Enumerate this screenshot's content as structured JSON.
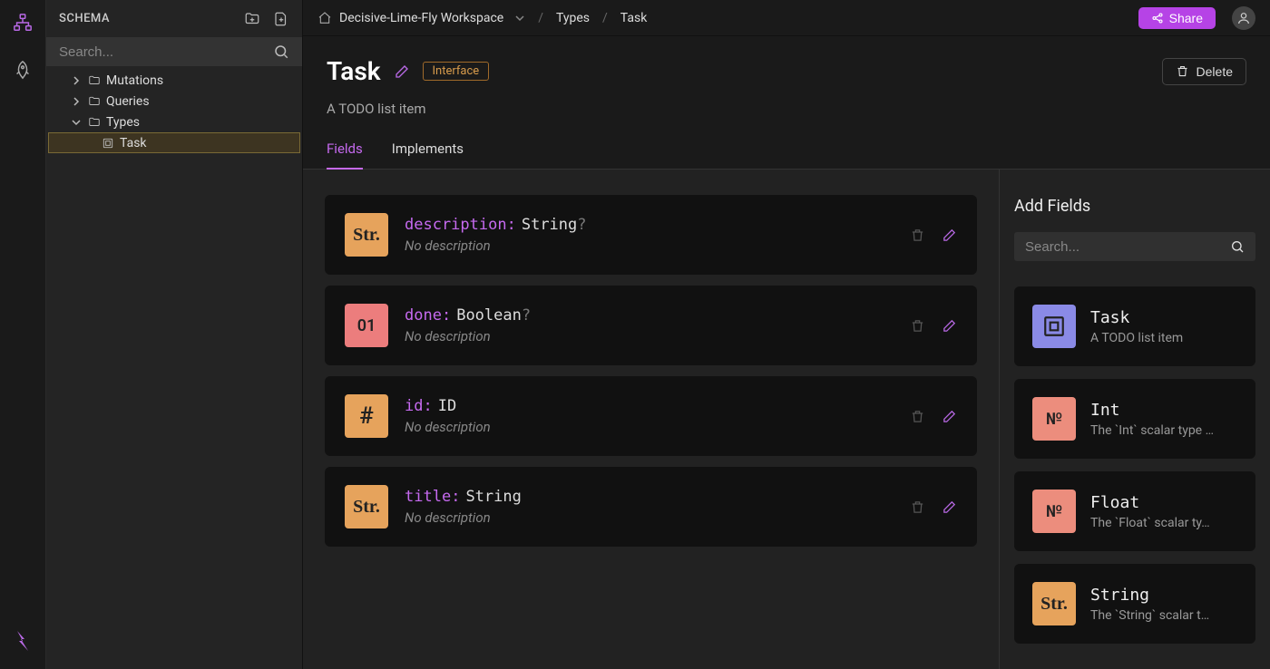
{
  "sidebar": {
    "title": "SCHEMA",
    "search_placeholder": "Search...",
    "items": [
      {
        "label": "Mutations",
        "expanded": false
      },
      {
        "label": "Queries",
        "expanded": false
      },
      {
        "label": "Types",
        "expanded": true
      }
    ],
    "type_children": [
      {
        "label": "Task",
        "selected": true
      }
    ]
  },
  "breadcrumb": {
    "workspace": "Decisive-Lime-Fly Workspace",
    "section": "Types",
    "item": "Task"
  },
  "topbar": {
    "share": "Share"
  },
  "page": {
    "title": "Task",
    "badge": "Interface",
    "delete": "Delete",
    "subtitle": "A TODO list item"
  },
  "tabs": {
    "fields": "Fields",
    "implements": "Implements"
  },
  "fields": [
    {
      "name": "description",
      "type": "String",
      "nullable": true,
      "badge": "Str.",
      "badge_kind": "tb-str",
      "desc": "No description"
    },
    {
      "name": "done",
      "type": "Boolean",
      "nullable": true,
      "badge": "01",
      "badge_kind": "tb-bool",
      "desc": "No description"
    },
    {
      "name": "id",
      "type": "ID",
      "nullable": false,
      "badge": "#",
      "badge_kind": "tb-hash",
      "desc": "No description"
    },
    {
      "name": "title",
      "type": "String",
      "nullable": false,
      "badge": "Str.",
      "badge_kind": "tb-str",
      "desc": "No description"
    }
  ],
  "add_panel": {
    "title": "Add Fields",
    "search_placeholder": "Search...",
    "types": [
      {
        "name": "Task",
        "desc": "A TODO list item",
        "badge": "◫",
        "badge_kind": "tb-obj"
      },
      {
        "name": "Int",
        "desc": "The `Int` scalar type …",
        "badge": "№",
        "badge_kind": "tb-num"
      },
      {
        "name": "Float",
        "desc": "The `Float` scalar ty…",
        "badge": "№",
        "badge_kind": "tb-num"
      },
      {
        "name": "String",
        "desc": "The `String` scalar t…",
        "badge": "Str.",
        "badge_kind": "tb-str"
      }
    ]
  }
}
